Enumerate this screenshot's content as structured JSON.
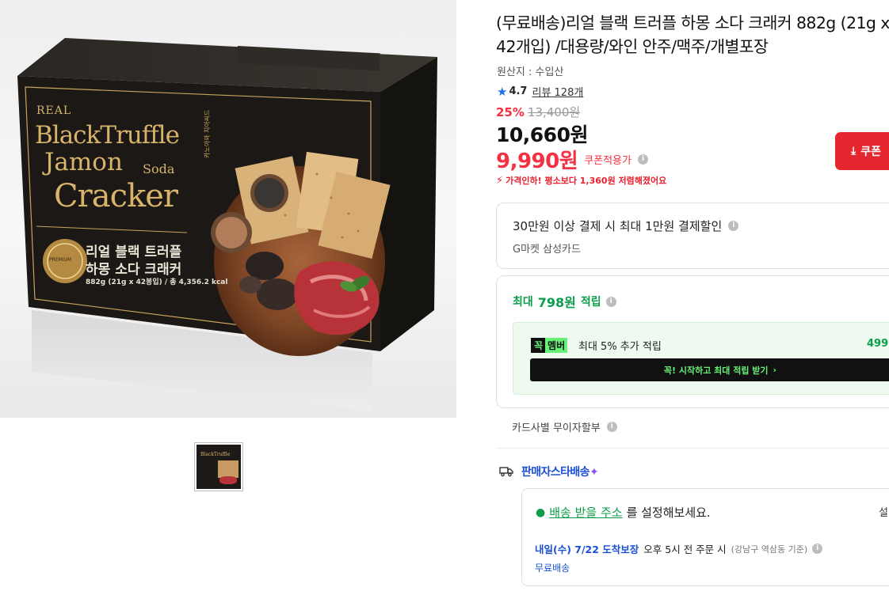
{
  "product": {
    "title": "(무료배송)리얼 블랙 트러플 하몽 소다 크래커 882g (21g x 42개입) /대용량/와인 안주/맥주/개별포장",
    "origin": "원산지 : 수입산",
    "rating": "4.7",
    "reviews": "리뷰 128개",
    "discount_rate": "25%",
    "original_price": "13,400원",
    "sale_price": "10,660원",
    "coupon_price": "9,990원",
    "coupon_label": "쿠폰적용가",
    "price_drop_note": "가격인하! 평소보다 1,360원 저렴해졌어요",
    "coupon_button": "쿠폰"
  },
  "box_art": {
    "real": "REAL",
    "black_truffle": "BlackTruffle",
    "jamon": "Jamon",
    "soda": "Soda",
    "cracker": "Cracker",
    "kr_line1": "리얼 블랙 트러플",
    "kr_line2": "하몽 소다 크래커",
    "weight": "882g (21g x 42봉입) / 총 4,356.2 kcal",
    "premium": "PREMIUM",
    "side_text": "카노아와 치아씨드"
  },
  "card_discount": {
    "title": "30만원 이상 결제 시 최대 1만원 결제할인",
    "subtitle": "G마켓 삼성카드"
  },
  "points": {
    "prefix": "최대",
    "amount": "798원",
    "suffix": "적립",
    "member_badge_1": "꼭",
    "member_badge_2": "멤버",
    "member_text": "최대 5% 추가 적립",
    "member_value": "499",
    "member_button": "꼭! 시작하고 최대 적립 받기"
  },
  "installment": "카드사별 무이자할부",
  "shipping": {
    "seller_label_1": "판매자",
    "seller_label_2": "스타배송",
    "address_link": "배송 받을 주소",
    "address_suffix": "를 설정해보세요.",
    "address_set": "설",
    "delivery_date": "내일(수) 7/22 도착보장",
    "cutoff": "오후 5시 전 주문 시",
    "cutoff_note": "(강남구 역삼동 기준)",
    "fee": "무료배송"
  },
  "colors": {
    "discount_red": "#f43142",
    "points_green": "#0b9e4a",
    "delivery_blue": "#1a4fd6",
    "member_green": "#67f277"
  }
}
